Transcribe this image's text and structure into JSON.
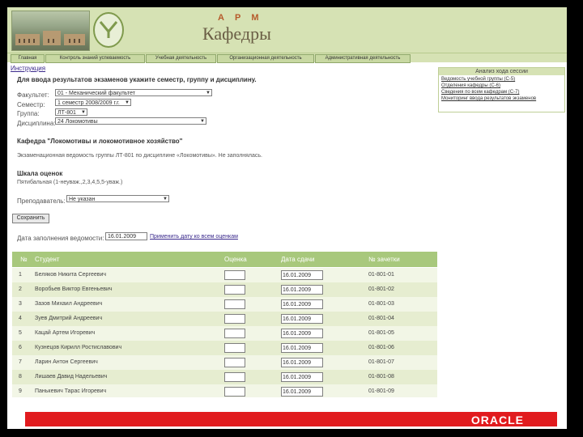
{
  "header": {
    "arm": "А Р М",
    "title": "Кафедры"
  },
  "nav": [
    {
      "label": "Главная"
    },
    {
      "label": "Контроль знаний успеваемость"
    },
    {
      "label": "Учебная деятельность"
    },
    {
      "label": "Организационная деятельность"
    },
    {
      "label": "Административная деятельность"
    }
  ],
  "instruction_link": "Инструкция",
  "heading": "Для ввода результатов экзаменов укажите семестр, группу и дисциплину.",
  "form": {
    "faculty_label": "Факультет:",
    "faculty_value": "01 - Механический факультет",
    "semester_label": "Семестр:",
    "semester_value": "1 семестр 2008/2009 г.г.",
    "group_label": "Группа:",
    "group_value": "ЛТ-801",
    "discipline_label": "Дисциплина:",
    "discipline_value": "24 Локомотивы"
  },
  "department": "Кафедра \"Локомотивы и локомотивное хозяйство\"",
  "sheet_status": "Экзаменационная ведомость группы ЛТ-801 по дисциплине «Локомотивы». Не заполнялась.",
  "scale": {
    "title": "Шкала оценок",
    "value": "Пятибальная (1-неуваж.,2,3,4,5,5-уваж.)"
  },
  "teacher": {
    "label": "Преподаватель:",
    "value": "Не указан"
  },
  "save_button": "Сохранить",
  "fill_date": {
    "label": "Дата заполнения ведомости:",
    "value": "16.01.2009",
    "apply_link": "Применить дату ко всем оценкам"
  },
  "side_panel": {
    "title": "Анализ хода сессии",
    "links": [
      "Ведомость учебной группы (С-5)",
      "Отделения кафедры (С-6)",
      "Сведения по всем кафедрам (С-7)",
      "Мониторинг ввода результатов экзаменов"
    ]
  },
  "table": {
    "headers": [
      "№",
      "Студент",
      "Оценка",
      "Дата сдачи",
      "№ зачетки"
    ],
    "rows": [
      {
        "n": "1",
        "student": "Беляков Никита Сергеевич",
        "date": "16.01.2009",
        "record": "01-801-01"
      },
      {
        "n": "2",
        "student": "Воробьев Виктор Евгеньевич",
        "date": "16.01.2009",
        "record": "01-801-02"
      },
      {
        "n": "3",
        "student": "Зазов Михаил Андреевич",
        "date": "16.01.2009",
        "record": "01-801-03"
      },
      {
        "n": "4",
        "student": "Зуев Дмитрий Андреевич",
        "date": "16.01.2009",
        "record": "01-801-04"
      },
      {
        "n": "5",
        "student": "Кацай Артем Игоревич",
        "date": "16.01.2009",
        "record": "01-801-05"
      },
      {
        "n": "6",
        "student": "Кузнецов Кирилл Ростиславович",
        "date": "16.01.2009",
        "record": "01-801-06"
      },
      {
        "n": "7",
        "student": "Ларин Антон Сергеевич",
        "date": "16.01.2009",
        "record": "01-801-07"
      },
      {
        "n": "8",
        "student": "Лишаев Давид Надельевич",
        "date": "16.01.2009",
        "record": "01-801-08"
      },
      {
        "n": "9",
        "student": "Панькевич Тарас Игоревич",
        "date": "16.01.2009",
        "record": "01-801-09"
      }
    ]
  },
  "footer": {
    "brand": "ORACLE"
  }
}
